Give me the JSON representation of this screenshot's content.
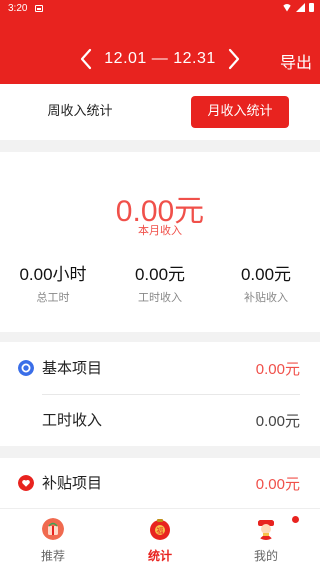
{
  "status_bar": {
    "time": "3:20",
    "left_icon": "photo-icon",
    "right_icons": [
      "wifi-icon",
      "signal-icon",
      "battery-icon"
    ]
  },
  "header": {
    "date_range": "12.01 — 12.31",
    "export_label": "导出",
    "prev_icon": "chevron-left-icon",
    "next_icon": "chevron-right-icon",
    "background_color": "#e8231f"
  },
  "tabs": {
    "week_label": "周收入统计",
    "month_label": "月收入统计",
    "selected": "month"
  },
  "summary": {
    "month_amount": "0.00元",
    "month_label": "本月收入",
    "stats": [
      {
        "value": "0.00小时",
        "label": "总工时"
      },
      {
        "value": "0.00元",
        "label": "工时收入"
      },
      {
        "value": "0.00元",
        "label": "补贴收入"
      }
    ]
  },
  "basic_section": {
    "icon": "circle-icon",
    "title": "基本项目",
    "total": "0.00元",
    "items": [
      {
        "label": "工时收入",
        "value": "0.00元"
      }
    ]
  },
  "subsidy_section": {
    "icon": "heart-icon",
    "title": "补贴项目",
    "total": "0.00元"
  },
  "bottom_nav": [
    {
      "label": "推荐",
      "icon": "gift-icon"
    },
    {
      "label": "统计",
      "icon": "fortune-icon"
    },
    {
      "label": "我的",
      "icon": "god-of-wealth-icon"
    }
  ],
  "bottom_nav_active": "统计",
  "accent_color": "#f0504a"
}
